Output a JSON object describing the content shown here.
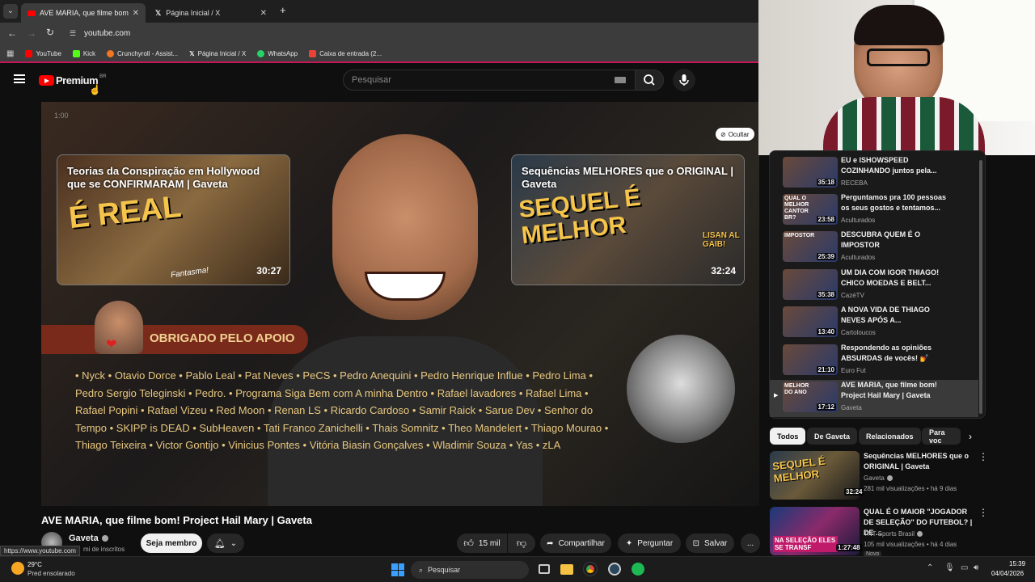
{
  "browser": {
    "tabs": [
      {
        "label": "AVE MARIA, que filme bom! Pr",
        "active": true
      },
      {
        "label": "Página Inicial / X",
        "active": false
      }
    ],
    "new_tab": "+",
    "url": "youtube.com",
    "bookmarks": [
      "YouTube",
      "Kick",
      "Crunchyroll - Assist...",
      "Página Inicial / X",
      "WhatsApp",
      "Caixa de entrada (2..."
    ],
    "status_url": "https://www.youtube.com"
  },
  "youtube": {
    "logo": "Premium",
    "region": "BR",
    "search_placeholder": "Pesquisar"
  },
  "player": {
    "overlay_time": "1:00",
    "hide_label": "Ocultar",
    "endcards": [
      {
        "title": "Teorias da Conspiração em Hollywood que se CONFIRMARAM | Gaveta",
        "duration": "30:27"
      },
      {
        "title": "Sequências MELHORES que o ORIGINAL | Gaveta",
        "duration": "32:24"
      }
    ],
    "thumb_texts": [
      "É REAL",
      "Fantasma!",
      "SEQUEL É MELHOR",
      "LISAN AL GAIB!"
    ],
    "thanks": "OBRIGADO PELO APOIO",
    "supporters": "• Nyck • Otavio Dorce • Pablo Leal • Pat Neves • PeCS • Pedro Anequini • Pedro Henrique Influe • Pedro Lima • Pedro Sergio Teleginski • Pedro. • Programa Siga Bem com A minha Dentro • Rafael lavadores • Rafael Lima • Rafael Popini • Rafael Vizeu • Red Moon • Renan LS • Ricardo Cardoso • Samir Raick • Sarue Dev • Senhor do Tempo • SKIPP is DEAD • SubHeaven • Tati Franco Zanichelli • Thais Somnitz • Theo Mandelert • Thiago Mourao • Thiago Teixeira • Victor Gontijo • Vinicius Pontes • Vitória Biasin Gonçalves • Wladimir Souza • Yas • zLA"
  },
  "video": {
    "title": "AVE MARIA, que filme bom! Project Hail Mary | Gaveta",
    "channel": "Gaveta",
    "subscribers": "mi de inscritos",
    "join": "Seja membro",
    "likes": "15 mil",
    "share": "Compartilhar",
    "ask": "Perguntar",
    "save": "Salvar",
    "more": "..."
  },
  "playlist": [
    {
      "title": "EU e ISHOWSPEED COZINHANDO juntos pela...",
      "channel": "RECEBA",
      "duration": "35:18"
    },
    {
      "title": "Perguntamos pra 100 pessoas os seus gostos e tentamos...",
      "channel": "Aculturados",
      "duration": "23:58",
      "thumb_text": "QUAL O MELHOR CANTOR BR?"
    },
    {
      "title": "DESCUBRA QUEM É O IMPOSTOR",
      "channel": "Aculturados",
      "duration": "25:39",
      "thumb_text": "IMPOSTOR"
    },
    {
      "title": "UM DIA COM IGOR THIAGO! CHICO MOEDAS E BELT...",
      "channel": "CazéTV",
      "duration": "35:38"
    },
    {
      "title": "A NOVA VIDA DE THIAGO NEVES APÓS A...",
      "channel": "Cartoloucos",
      "duration": "13:40"
    },
    {
      "title": "Respondendo as opiniões ABSURDAS de vocês! 💅",
      "channel": "Euro Fut",
      "duration": "21:10"
    },
    {
      "title": "AVE MARIA, que filme bom! Project Hail Mary | Gaveta",
      "channel": "Gaveta",
      "duration": "17:12",
      "current": true,
      "thumb_text": "MELHOR DO ANO"
    }
  ],
  "chips": [
    "Todos",
    "De Gaveta",
    "Relacionados",
    "Para voc"
  ],
  "recommendations": [
    {
      "title": "Sequências MELHORES que o ORIGINAL | Gaveta",
      "channel": "Gaveta",
      "meta": "281 mil visualizações • há 9 dias",
      "duration": "32:24",
      "thumb_text": "SEQUEL É MELHOR"
    },
    {
      "title": "QUAL É O MAIOR \"JOGADOR DE SELEÇÃO\" DO FUTEBOL? | DE ...",
      "channel": "TNT Sports Brasil",
      "meta": "105 mil visualizações • há 4 dias",
      "duration": "1:27:48",
      "badge": "Novo",
      "thumb_text": "NA SELEÇÃO ELES SE TRANSF"
    }
  ],
  "taskbar": {
    "temp": "29°C",
    "weather": "Pred ensolarado",
    "search": "Pesquisar",
    "time": "15:39",
    "date": "04/04/2026"
  },
  "colors": {
    "youtube_red": "#ff0000",
    "accent_border": "#c2185b"
  }
}
